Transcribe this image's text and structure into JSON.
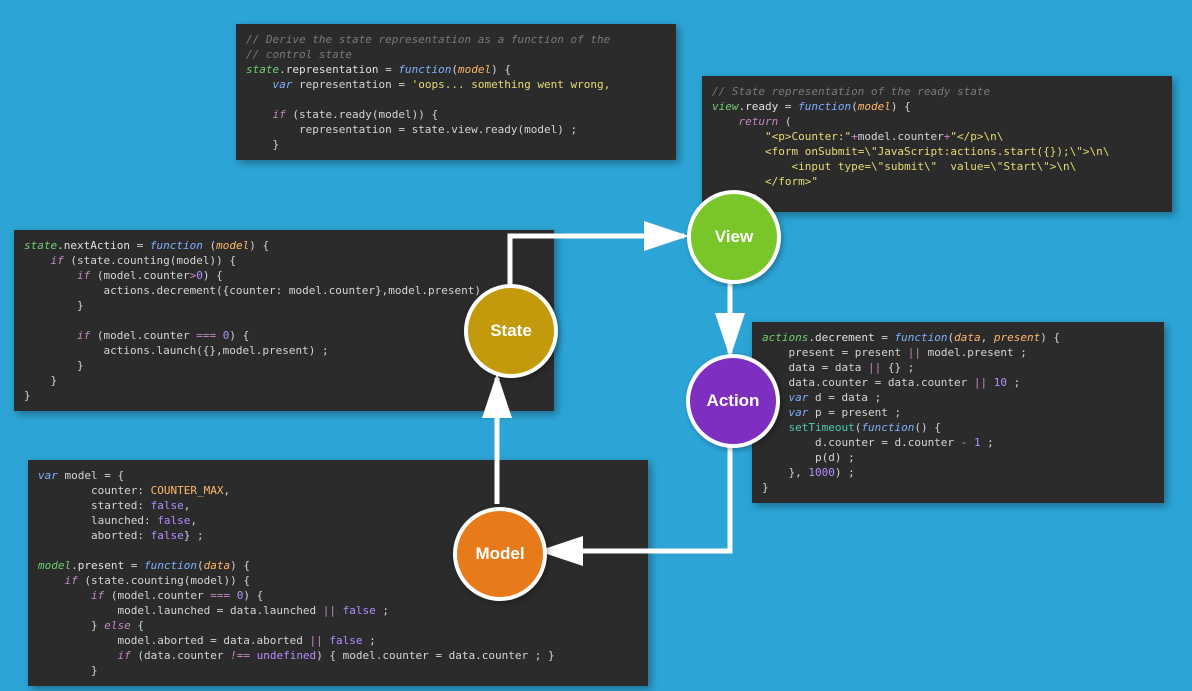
{
  "nodes": {
    "state": "State",
    "view": "View",
    "action": "Action",
    "model": "Model"
  },
  "code": {
    "state_rep": [
      {
        "t": "comment",
        "v": "// Derive the state representation as a function of the"
      },
      {
        "t": "comment",
        "v": "// control state"
      },
      {
        "t": "tokens",
        "v": [
          {
            "c": "obj",
            "t": "state"
          },
          {
            "c": "punc",
            "t": "."
          },
          {
            "c": "prop",
            "t": "representation"
          },
          {
            "c": "punc",
            "t": " = "
          },
          {
            "c": "kw",
            "t": "function"
          },
          {
            "c": "punc",
            "t": "("
          },
          {
            "c": "param",
            "t": "model"
          },
          {
            "c": "punc",
            "t": ") {"
          }
        ]
      },
      {
        "t": "tokens",
        "v": [
          {
            "c": "punc",
            "t": "    "
          },
          {
            "c": "kw",
            "t": "var"
          },
          {
            "c": "punc",
            "t": " representation = "
          },
          {
            "c": "str",
            "t": "'oops... something went wrong,"
          }
        ]
      },
      {
        "t": "tokens",
        "v": [
          {
            "c": "punc",
            "t": ""
          }
        ]
      },
      {
        "t": "tokens",
        "v": [
          {
            "c": "punc",
            "t": "    "
          },
          {
            "c": "rkw",
            "t": "if"
          },
          {
            "c": "punc",
            "t": " (state.ready(model)) {"
          }
        ]
      },
      {
        "t": "tokens",
        "v": [
          {
            "c": "punc",
            "t": "        representation = state.view.ready(model) ;"
          }
        ]
      },
      {
        "t": "tokens",
        "v": [
          {
            "c": "punc",
            "t": "    }"
          }
        ]
      }
    ],
    "state_next": [
      {
        "t": "tokens",
        "v": [
          {
            "c": "obj",
            "t": "state"
          },
          {
            "c": "punc",
            "t": "."
          },
          {
            "c": "prop",
            "t": "nextAction"
          },
          {
            "c": "punc",
            "t": " = "
          },
          {
            "c": "kw",
            "t": "function"
          },
          {
            "c": "punc",
            "t": " ("
          },
          {
            "c": "param",
            "t": "model"
          },
          {
            "c": "punc",
            "t": ") {"
          }
        ]
      },
      {
        "t": "tokens",
        "v": [
          {
            "c": "punc",
            "t": "    "
          },
          {
            "c": "rkw",
            "t": "if"
          },
          {
            "c": "punc",
            "t": " (state.counting(model)) {"
          }
        ]
      },
      {
        "t": "tokens",
        "v": [
          {
            "c": "punc",
            "t": "        "
          },
          {
            "c": "rkw",
            "t": "if"
          },
          {
            "c": "punc",
            "t": " (model.counter"
          },
          {
            "c": "rkw",
            "t": ">"
          },
          {
            "c": "num",
            "t": "0"
          },
          {
            "c": "punc",
            "t": ") {"
          }
        ]
      },
      {
        "t": "tokens",
        "v": [
          {
            "c": "punc",
            "t": "            actions.decrement({counter: model.counter},model.present"
          },
          {
            "c": "punc",
            "t": ") ;"
          }
        ]
      },
      {
        "t": "tokens",
        "v": [
          {
            "c": "punc",
            "t": "        }"
          }
        ]
      },
      {
        "t": "tokens",
        "v": [
          {
            "c": "punc",
            "t": ""
          }
        ]
      },
      {
        "t": "tokens",
        "v": [
          {
            "c": "punc",
            "t": "        "
          },
          {
            "c": "rkw",
            "t": "if"
          },
          {
            "c": "punc",
            "t": " (model.counter "
          },
          {
            "c": "rkw",
            "t": "==="
          },
          {
            "c": "punc",
            "t": " "
          },
          {
            "c": "num",
            "t": "0"
          },
          {
            "c": "punc",
            "t": ") {"
          }
        ]
      },
      {
        "t": "tokens",
        "v": [
          {
            "c": "punc",
            "t": "            actions.launch({},model.present) ;"
          }
        ]
      },
      {
        "t": "tokens",
        "v": [
          {
            "c": "punc",
            "t": "        }"
          }
        ]
      },
      {
        "t": "tokens",
        "v": [
          {
            "c": "punc",
            "t": "    }"
          }
        ]
      },
      {
        "t": "tokens",
        "v": [
          {
            "c": "punc",
            "t": "}"
          }
        ]
      }
    ],
    "view_ready": [
      {
        "t": "comment",
        "v": "// State representation of the ready state"
      },
      {
        "t": "tokens",
        "v": [
          {
            "c": "obj",
            "t": "view"
          },
          {
            "c": "punc",
            "t": "."
          },
          {
            "c": "prop",
            "t": "ready"
          },
          {
            "c": "punc",
            "t": " = "
          },
          {
            "c": "kw",
            "t": "function"
          },
          {
            "c": "punc",
            "t": "("
          },
          {
            "c": "param",
            "t": "model"
          },
          {
            "c": "punc",
            "t": ") {"
          }
        ]
      },
      {
        "t": "tokens",
        "v": [
          {
            "c": "punc",
            "t": "    "
          },
          {
            "c": "rkw",
            "t": "return"
          },
          {
            "c": "punc",
            "t": " ("
          }
        ]
      },
      {
        "t": "tokens",
        "v": [
          {
            "c": "punc",
            "t": "        "
          },
          {
            "c": "str",
            "t": "\"<p>Counter:\""
          },
          {
            "c": "rkw",
            "t": "+"
          },
          {
            "c": "punc",
            "t": "model.counter"
          },
          {
            "c": "rkw",
            "t": "+"
          },
          {
            "c": "str",
            "t": "\"</p>\\n\\"
          }
        ]
      },
      {
        "t": "tokens",
        "v": [
          {
            "c": "punc",
            "t": "        "
          },
          {
            "c": "str",
            "t": "<form onSubmit=\\\"JavaScript:actions.start({});\\\">\\n\\"
          }
        ]
      },
      {
        "t": "tokens",
        "v": [
          {
            "c": "punc",
            "t": "            "
          },
          {
            "c": "str",
            "t": "<input type=\\\"submit\\\"  value=\\\"Start\\\">\\n\\"
          }
        ]
      },
      {
        "t": "tokens",
        "v": [
          {
            "c": "punc",
            "t": "        "
          },
          {
            "c": "str",
            "t": "</form>\""
          }
        ]
      },
      {
        "t": "tokens",
        "v": [
          {
            "c": "punc",
            "t": "    ) ;"
          }
        ]
      }
    ],
    "action_dec": [
      {
        "t": "tokens",
        "v": [
          {
            "c": "obj",
            "t": "actions"
          },
          {
            "c": "punc",
            "t": "."
          },
          {
            "c": "prop",
            "t": "decrement"
          },
          {
            "c": "punc",
            "t": " = "
          },
          {
            "c": "kw",
            "t": "function"
          },
          {
            "c": "punc",
            "t": "("
          },
          {
            "c": "param",
            "t": "data"
          },
          {
            "c": "punc",
            "t": ", "
          },
          {
            "c": "param",
            "t": "present"
          },
          {
            "c": "punc",
            "t": ") {"
          }
        ]
      },
      {
        "t": "tokens",
        "v": [
          {
            "c": "punc",
            "t": "    present = present "
          },
          {
            "c": "rkw",
            "t": "||"
          },
          {
            "c": "punc",
            "t": " model.present ;"
          }
        ]
      },
      {
        "t": "tokens",
        "v": [
          {
            "c": "punc",
            "t": "    data = data "
          },
          {
            "c": "rkw",
            "t": "||"
          },
          {
            "c": "punc",
            "t": " {} ;"
          }
        ]
      },
      {
        "t": "tokens",
        "v": [
          {
            "c": "punc",
            "t": "    data.counter = data.counter "
          },
          {
            "c": "rkw",
            "t": "||"
          },
          {
            "c": "punc",
            "t": " "
          },
          {
            "c": "num",
            "t": "10"
          },
          {
            "c": "punc",
            "t": " ;"
          }
        ]
      },
      {
        "t": "tokens",
        "v": [
          {
            "c": "punc",
            "t": "    "
          },
          {
            "c": "kw",
            "t": "var"
          },
          {
            "c": "punc",
            "t": " d = data ;"
          }
        ]
      },
      {
        "t": "tokens",
        "v": [
          {
            "c": "punc",
            "t": "    "
          },
          {
            "c": "kw",
            "t": "var"
          },
          {
            "c": "punc",
            "t": " p = present ;"
          }
        ]
      },
      {
        "t": "tokens",
        "v": [
          {
            "c": "punc",
            "t": "    "
          },
          {
            "c": "fn",
            "t": "setTimeout"
          },
          {
            "c": "punc",
            "t": "("
          },
          {
            "c": "kw",
            "t": "function"
          },
          {
            "c": "punc",
            "t": "() {"
          }
        ]
      },
      {
        "t": "tokens",
        "v": [
          {
            "c": "punc",
            "t": "        d.counter = d.counter "
          },
          {
            "c": "rkw",
            "t": "-"
          },
          {
            "c": "punc",
            "t": " "
          },
          {
            "c": "num",
            "t": "1"
          },
          {
            "c": "punc",
            "t": " ;"
          }
        ]
      },
      {
        "t": "tokens",
        "v": [
          {
            "c": "punc",
            "t": "        p(d) ;"
          }
        ]
      },
      {
        "t": "tokens",
        "v": [
          {
            "c": "punc",
            "t": "    }, "
          },
          {
            "c": "num",
            "t": "1000"
          },
          {
            "c": "punc",
            "t": ") ;"
          }
        ]
      },
      {
        "t": "tokens",
        "v": [
          {
            "c": "punc",
            "t": "}"
          }
        ]
      }
    ],
    "model_def": [
      {
        "t": "tokens",
        "v": [
          {
            "c": "kw",
            "t": "var"
          },
          {
            "c": "punc",
            "t": " model = {"
          }
        ]
      },
      {
        "t": "tokens",
        "v": [
          {
            "c": "punc",
            "t": "        counter: "
          },
          {
            "c": "const",
            "t": "COUNTER_MAX"
          },
          {
            "c": "punc",
            "t": ","
          }
        ]
      },
      {
        "t": "tokens",
        "v": [
          {
            "c": "punc",
            "t": "        started: "
          },
          {
            "c": "num",
            "t": "false"
          },
          {
            "c": "punc",
            "t": ","
          }
        ]
      },
      {
        "t": "tokens",
        "v": [
          {
            "c": "punc",
            "t": "        launched: "
          },
          {
            "c": "num",
            "t": "false"
          },
          {
            "c": "punc",
            "t": ","
          }
        ]
      },
      {
        "t": "tokens",
        "v": [
          {
            "c": "punc",
            "t": "        aborted: "
          },
          {
            "c": "num",
            "t": "false"
          },
          {
            "c": "punc",
            "t": "} ;"
          }
        ]
      },
      {
        "t": "tokens",
        "v": [
          {
            "c": "punc",
            "t": ""
          }
        ]
      },
      {
        "t": "tokens",
        "v": [
          {
            "c": "obj",
            "t": "model"
          },
          {
            "c": "punc",
            "t": "."
          },
          {
            "c": "prop",
            "t": "present"
          },
          {
            "c": "punc",
            "t": " = "
          },
          {
            "c": "kw",
            "t": "function"
          },
          {
            "c": "punc",
            "t": "("
          },
          {
            "c": "param",
            "t": "data"
          },
          {
            "c": "punc",
            "t": ") {"
          }
        ]
      },
      {
        "t": "tokens",
        "v": [
          {
            "c": "punc",
            "t": "    "
          },
          {
            "c": "rkw",
            "t": "if"
          },
          {
            "c": "punc",
            "t": " (state.counting(model)) {"
          }
        ]
      },
      {
        "t": "tokens",
        "v": [
          {
            "c": "punc",
            "t": "        "
          },
          {
            "c": "rkw",
            "t": "if"
          },
          {
            "c": "punc",
            "t": " (model.counter "
          },
          {
            "c": "rkw",
            "t": "==="
          },
          {
            "c": "punc",
            "t": " "
          },
          {
            "c": "num",
            "t": "0"
          },
          {
            "c": "punc",
            "t": ") {"
          }
        ]
      },
      {
        "t": "tokens",
        "v": [
          {
            "c": "punc",
            "t": "            model.launched = data.launched "
          },
          {
            "c": "rkw",
            "t": "||"
          },
          {
            "c": "punc",
            "t": " "
          },
          {
            "c": "num",
            "t": "false"
          },
          {
            "c": "punc",
            "t": " ;"
          }
        ]
      },
      {
        "t": "tokens",
        "v": [
          {
            "c": "punc",
            "t": "        } "
          },
          {
            "c": "rkw",
            "t": "else"
          },
          {
            "c": "punc",
            "t": " {"
          }
        ]
      },
      {
        "t": "tokens",
        "v": [
          {
            "c": "punc",
            "t": "            model.aborted = data.aborted "
          },
          {
            "c": "rkw",
            "t": "||"
          },
          {
            "c": "punc",
            "t": " "
          },
          {
            "c": "num",
            "t": "false"
          },
          {
            "c": "punc",
            "t": " ;"
          }
        ]
      },
      {
        "t": "tokens",
        "v": [
          {
            "c": "punc",
            "t": "            "
          },
          {
            "c": "rkw",
            "t": "if"
          },
          {
            "c": "punc",
            "t": " (data.counter "
          },
          {
            "c": "rkw",
            "t": "!=="
          },
          {
            "c": "punc",
            "t": " "
          },
          {
            "c": "num",
            "t": "undefined"
          },
          {
            "c": "punc",
            "t": ") { model.counter = data.counter ; }"
          }
        ]
      },
      {
        "t": "tokens",
        "v": [
          {
            "c": "punc",
            "t": "        }"
          }
        ]
      }
    ]
  }
}
